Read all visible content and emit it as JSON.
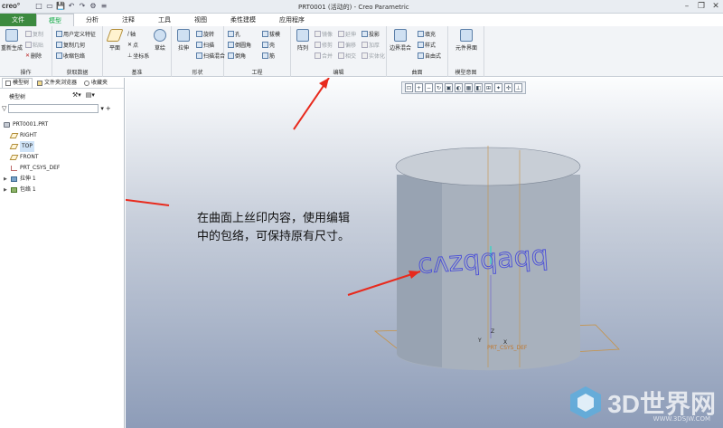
{
  "app": {
    "logo": "creo°",
    "title": "PRT0001 (活动的) - Creo Parametric"
  },
  "quick_access": [
    "□",
    "▭",
    "💾",
    "↶",
    "↷",
    "⚙",
    "≡"
  ],
  "window_controls": [
    "–",
    "❐",
    "✕"
  ],
  "tabs": [
    "文件",
    "模型",
    "分析",
    "注释",
    "工具",
    "视图",
    "柔性建模",
    "应用程序"
  ],
  "ribbon": {
    "operations": {
      "regen": "重新生成",
      "copy": "复制",
      "paste": "粘贴",
      "delete": "删除",
      "label": "操作"
    },
    "get_data": {
      "udf": "用户定义特征",
      "copy_geom": "复制几何",
      "shrinkwrap": "收缩包络",
      "label": "获取数据"
    },
    "datum": {
      "plane": "平面",
      "axis": "轴",
      "point": "点",
      "csys": "坐标系",
      "sketch": "草绘",
      "label": "基准"
    },
    "shapes": {
      "extrude": "拉伸",
      "revolve": "旋转",
      "sweep": "扫描",
      "swept_blend": "扫描混合",
      "label": "形状"
    },
    "engineering": {
      "hole": "孔",
      "round": "倒圆角",
      "chamfer": "倒角",
      "draft": "拔模",
      "shell": "壳",
      "rib": "筋",
      "label": "工程"
    },
    "editing": {
      "pattern": "阵列",
      "mirror": "镜像",
      "trim": "修剪",
      "merge": "合并",
      "extend": "延伸",
      "offset": "偏移",
      "intersect": "相交",
      "project": "投影",
      "thicken": "加厚",
      "solidify": "实体化",
      "label": "编辑"
    },
    "surfaces": {
      "boundary": "边界混合",
      "fill": "填充",
      "style": "样式",
      "freestyle": "自由式",
      "label": "曲面"
    },
    "model_intent": {
      "element": "元件界面",
      "label": "模型意图"
    }
  },
  "left_panel": {
    "tabs": [
      "模型树",
      "文件夹浏览器",
      "收藏夹"
    ],
    "model_tree_label": "模型树",
    "tree": [
      {
        "label": "PRT0001.PRT",
        "icon": "part"
      },
      {
        "label": "RIGHT",
        "icon": "plane"
      },
      {
        "label": "TOP",
        "icon": "plane"
      },
      {
        "label": "FRONT",
        "icon": "plane"
      },
      {
        "label": "PRT_CSYS_DEF",
        "icon": "csys"
      },
      {
        "label": "拉伸 1",
        "icon": "ext"
      },
      {
        "label": "包络 1",
        "icon": "wrap"
      }
    ]
  },
  "viewport": {
    "annotation_line1": "在曲面上丝印内容，使用编辑",
    "annotation_line2": "中的包络，可保持原有尺寸。",
    "wrapped_text": "cʌzqqaqq",
    "csys_label": "PRT_CSYS_DEF",
    "axis_x": "X",
    "axis_y": "Y",
    "axis_z": "Z"
  },
  "watermark": {
    "main": "3D世界网",
    "url": "WWW.3DSJW.COM"
  }
}
